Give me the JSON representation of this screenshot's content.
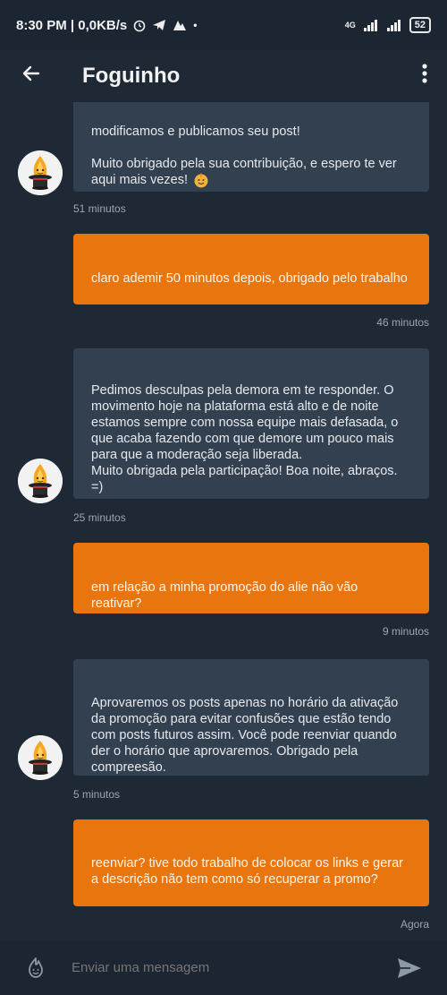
{
  "status_bar": {
    "time_speed": "8:30 PM | 0,0KB/s",
    "network": "4G",
    "battery": "52"
  },
  "header": {
    "title": "Foguinho"
  },
  "messages": [
    {
      "id": "m1",
      "direction": "in",
      "text": "modificamos e publicamos seu post!\n\nMuito obrigado pela sua contribuição, e espero te ver aqui mais vezes!",
      "time": "51 minutos",
      "has_emoji": true
    },
    {
      "id": "m2",
      "direction": "out",
      "text": "claro ademir 50 minutos depois, obrigado pelo trabalho",
      "time": "46 minutos"
    },
    {
      "id": "m3",
      "direction": "in",
      "text": "Pedimos desculpas pela demora em te responder. O movimento hoje na plataforma está alto e de noite estamos sempre com nossa equipe mais defasada, o que acaba fazendo com que demore um pouco mais para que a moderação seja liberada.\nMuito obrigada pela participação! Boa noite, abraços. =)",
      "time": "25 minutos"
    },
    {
      "id": "m4",
      "direction": "out",
      "text": "em relação a minha promoção do alie não vão reativar?",
      "time": "9 minutos"
    },
    {
      "id": "m5",
      "direction": "in",
      "text": "Aprovaremos os posts apenas no horário da ativação da promoção para evitar confusões que estão tendo com posts futuros assim. Você pode reenviar quando der o horário que aprovaremos. Obrigado pela compreesão.",
      "time": "5 minutos"
    },
    {
      "id": "m6",
      "direction": "out",
      "text": "reenviar? tive todo trabalho de colocar os links e gerar a descrição não tem como só recuperar a promo?",
      "time": "Agora"
    }
  ],
  "composer": {
    "placeholder": "Enviar uma mensagem"
  },
  "colors": {
    "background": "#1f2936",
    "incoming": "#33404f",
    "outgoing": "#e8750e",
    "timestamp": "#9aa6b4"
  },
  "icons": {
    "back": "arrow-left-icon",
    "menu": "more-vertical-icon",
    "avatar": "fire-mascot-icon",
    "composer_left": "fire-emoji-icon",
    "send": "send-icon"
  }
}
